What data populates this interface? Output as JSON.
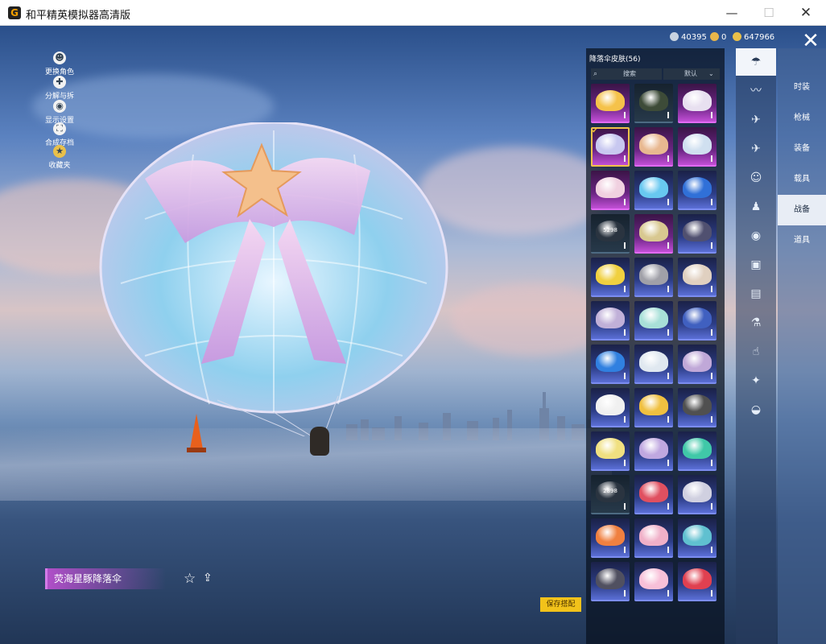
{
  "window": {
    "title": "和平精英模拟器高清版",
    "minimize": "—",
    "maximize": "☐",
    "close": "✕"
  },
  "currency": [
    {
      "value": "40395",
      "color": "#c9d3e0"
    },
    {
      "value": "0",
      "color": "#e9b64a"
    },
    {
      "value": "647966",
      "color": "#e9c04a"
    }
  ],
  "left_tools": [
    {
      "label": "更换角色",
      "icon": "person-icon"
    },
    {
      "label": "分解与拆解",
      "icon": "puzzle-icon"
    },
    {
      "label": "显示设置",
      "icon": "eye-icon"
    },
    {
      "label": "合成存档",
      "icon": "merge-icon"
    },
    {
      "label": "收藏夹",
      "icon": "badge-icon"
    }
  ],
  "selected_item": {
    "name": "荧海星豚降落伞",
    "fav_icon": "☆",
    "share_icon": "⇪"
  },
  "save_button": "保存搭配",
  "panel": {
    "title": "降落伞皮肤(56)",
    "search_label": "搜索",
    "search_icon": "⌕",
    "sort_label": "默认",
    "sort_chevron": "⌄"
  },
  "skins": [
    {
      "rarity": "purple",
      "color": "#f5c24a"
    },
    {
      "rarity": "grey",
      "color": "#3d4b38"
    },
    {
      "rarity": "purple",
      "color": "#e8e0f0"
    },
    {
      "rarity": "purple",
      "color": "#c8c8f0",
      "selected": true
    },
    {
      "rarity": "purple",
      "color": "#e8b890"
    },
    {
      "rarity": "purple",
      "color": "#d0e0f0"
    },
    {
      "rarity": "purple",
      "color": "#f0d0e0"
    },
    {
      "rarity": "blue",
      "color": "#68c8f0"
    },
    {
      "rarity": "blue",
      "color": "#3070d8"
    },
    {
      "rarity": "grey",
      "color": "#2a3440",
      "download": "5298"
    },
    {
      "rarity": "purple",
      "color": "#d8c890"
    },
    {
      "rarity": "blue",
      "color": "#505070"
    },
    {
      "rarity": "blue",
      "color": "#f0d040"
    },
    {
      "rarity": "blue",
      "color": "#a0a0a8"
    },
    {
      "rarity": "blue",
      "color": "#e0d0c0"
    },
    {
      "rarity": "blue",
      "color": "#c0b0d8"
    },
    {
      "rarity": "blue",
      "color": "#a8e0d8"
    },
    {
      "rarity": "blue",
      "color": "#4060c0"
    },
    {
      "rarity": "blue",
      "color": "#3080e0"
    },
    {
      "rarity": "blue",
      "color": "#e0e8f0"
    },
    {
      "rarity": "blue",
      "color": "#c0a8d8"
    },
    {
      "rarity": "blue",
      "color": "#f0f0f0"
    },
    {
      "rarity": "blue",
      "color": "#f0c040"
    },
    {
      "rarity": "blue",
      "color": "#505050"
    },
    {
      "rarity": "blue",
      "color": "#f0e080"
    },
    {
      "rarity": "blue",
      "color": "#c0a8e0"
    },
    {
      "rarity": "blue",
      "color": "#40c8a8"
    },
    {
      "rarity": "grey",
      "color": "#2a3440",
      "download": "2898"
    },
    {
      "rarity": "blue",
      "color": "#e05060"
    },
    {
      "rarity": "blue",
      "color": "#d0d0e0"
    },
    {
      "rarity": "blue",
      "color": "#f08040"
    },
    {
      "rarity": "blue",
      "color": "#f0b0c8"
    },
    {
      "rarity": "blue",
      "color": "#60c0d0"
    },
    {
      "rarity": "blue",
      "color": "#505060"
    },
    {
      "rarity": "blue",
      "color": "#f8c0d8"
    },
    {
      "rarity": "blue",
      "color": "#e04050"
    }
  ],
  "categories": [
    {
      "icon": "parachute-icon",
      "glyph": "☂",
      "active": true
    },
    {
      "icon": "wings-icon",
      "glyph": "〰"
    },
    {
      "icon": "helicopter-icon",
      "glyph": "✈"
    },
    {
      "icon": "plane-icon",
      "glyph": "✈"
    },
    {
      "icon": "emote-icon",
      "glyph": "☺"
    },
    {
      "icon": "pet-icon",
      "glyph": "♟"
    },
    {
      "icon": "broadcast-icon",
      "glyph": "◉"
    },
    {
      "icon": "sticker-icon",
      "glyph": "▣"
    },
    {
      "icon": "gallery-icon",
      "glyph": "▤"
    },
    {
      "icon": "spray-icon",
      "glyph": "⚗"
    },
    {
      "icon": "finger-icon",
      "glyph": "☝"
    },
    {
      "icon": "magic-icon",
      "glyph": "✦"
    },
    {
      "icon": "ufo-icon",
      "glyph": "◒"
    }
  ],
  "tabs": [
    {
      "label": "时装"
    },
    {
      "label": "枪械"
    },
    {
      "label": "装备"
    },
    {
      "label": "载具"
    },
    {
      "label": "战备",
      "active": true
    },
    {
      "label": "道具"
    }
  ]
}
